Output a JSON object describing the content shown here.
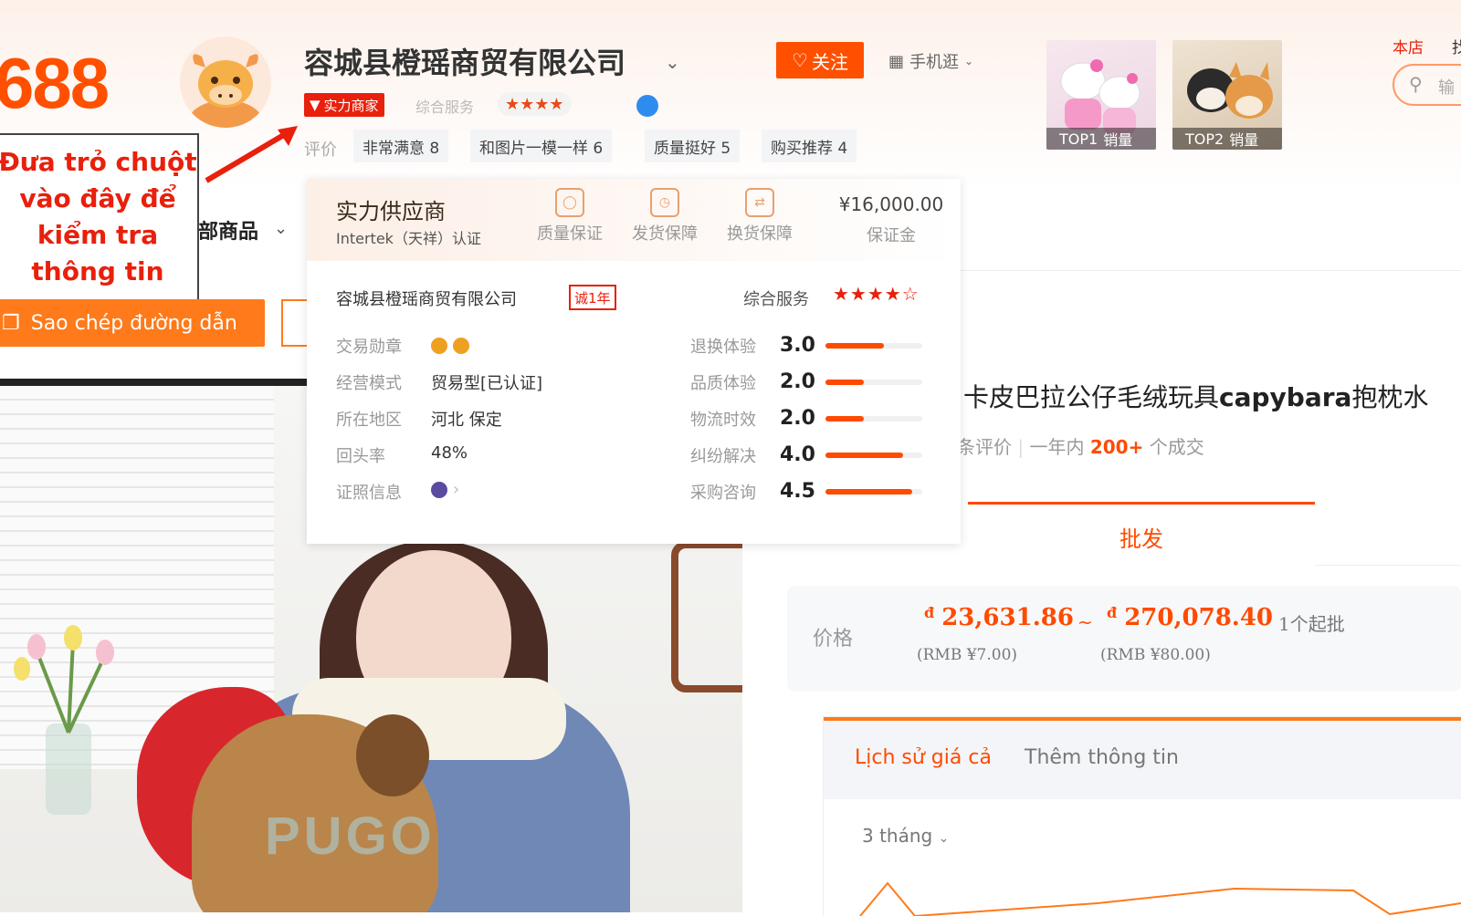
{
  "header": {
    "logo": "688",
    "company_name": "容城县橙瑶商贸有限公司",
    "follow_label": "关注",
    "mobile_label": "手机逛",
    "strength_badge": "实力商家",
    "service_label": "综合服务",
    "service_stars": "★★★★",
    "review_label": "评价",
    "review_tags": [
      "非常满意 8",
      "和图片一模一样 6",
      "质量挺好 5",
      "购买推荐 4"
    ],
    "top_items": [
      {
        "rank": "TOP1",
        "label": "销量"
      },
      {
        "rank": "TOP2",
        "label": "销量"
      }
    ],
    "store_link": "本店",
    "store_link2": "找",
    "search_placeholder": "输"
  },
  "annotation": {
    "text": "Đưa trỏ chuột vào đây để kiểm tra thông tin"
  },
  "nav": {
    "all_goods": "部商品",
    "copy_link": "Sao chép đường dẫn"
  },
  "photo": {
    "watermark": "PUGO"
  },
  "popup": {
    "title": "实力供应商",
    "subtitle": "Intertek（天祥）认证",
    "guarantees": [
      "质量保证",
      "发货保障",
      "换货保障"
    ],
    "deposit_amount": "¥16,000.00",
    "deposit_label": "保证金",
    "company_name": "容城县橙瑶商贸有限公司",
    "years_badge": "诚1年",
    "service_label": "综合服务",
    "service_stars": "★★★★☆",
    "info_rows": [
      {
        "label": "交易勋章",
        "value": ""
      },
      {
        "label": "经营模式",
        "value": "贸易型[已认证]"
      },
      {
        "label": "所在地区",
        "value": "河北 保定"
      },
      {
        "label": "回头率",
        "value": "48%"
      },
      {
        "label": "证照信息",
        "value": ""
      }
    ],
    "scores": [
      {
        "label": "退换体验",
        "score": "3.0",
        "fraction": 0.6
      },
      {
        "label": "品质体验",
        "score": "2.0",
        "fraction": 0.4
      },
      {
        "label": "物流时效",
        "score": "2.0",
        "fraction": 0.4
      },
      {
        "label": "纠纷解决",
        "score": "4.0",
        "fraction": 0.8
      },
      {
        "label": "采购咨询",
        "score": "4.5",
        "fraction": 0.9
      }
    ]
  },
  "product": {
    "title_prefix": "卡皮巴拉公仔毛绒玩具",
    "title_bold": "capybara",
    "title_suffix": "抱枕水",
    "stats_prefix": "条评价",
    "stats_mid": "一年内",
    "stats_count": "200+",
    "stats_suffix": "个成交",
    "wholesale_tab": "批发",
    "price_label": "价格",
    "currency_symbol": "đ",
    "price_low": "23,631.86",
    "price_high": "270,078.40",
    "price_tilde": "~",
    "rmb_low": "(RMB ¥7.00)",
    "rmb_high": "(RMB ¥80.00)",
    "min_batch": "1个起批"
  },
  "history": {
    "tab_price_history": "Lịch sử giá cả",
    "tab_more_info": "Thêm thông tin",
    "range_label": "3 tháng"
  },
  "colors": {
    "brand_orange": "#ff5000",
    "accent_red": "#e8200c"
  }
}
